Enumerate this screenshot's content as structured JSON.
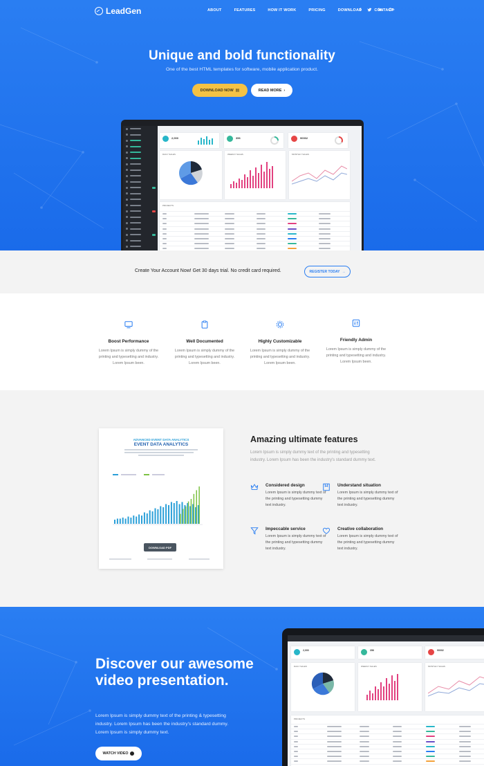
{
  "brand": {
    "name": "LeadGen"
  },
  "nav": {
    "items": [
      "ABOUT",
      "FEATURES",
      "HOW IT WORK",
      "PRICING",
      "DOWNLOAD",
      "CONTACT"
    ],
    "social": [
      "f",
      "t",
      "in",
      "G+"
    ]
  },
  "hero": {
    "title": "Unique and bold functionality",
    "subtitle": "One of the best HTML templates for software, mobile application product.",
    "download_label": "DOWNLOAD NOW",
    "readmore_label": "READ MORE"
  },
  "dashboard": {
    "kpis": [
      {
        "value": "2,000",
        "color": "#27b6c9"
      },
      {
        "value": "356",
        "color": "#35b89b"
      },
      {
        "value": "90002",
        "color": "#e64545"
      }
    ],
    "panels": [
      "DAILY SALES",
      "WEEKLY SALES",
      "MONTHLY SALES"
    ],
    "projects_label": "PROJECTS",
    "columns": [
      "#",
      "Project Name",
      "Start Date",
      "Due Date",
      "Status",
      "Assign"
    ]
  },
  "trial": {
    "text": "Create Your Account Now! Get 30 days trial. No credit card required.",
    "button": "REGISTER TODAY"
  },
  "features": [
    {
      "icon": "monitor-icon",
      "title": "Boost Performance",
      "desc": "Lorem Ipsum is simply dummy of the printing and typesetting and industry. Lorem Ipsum been."
    },
    {
      "icon": "clipboard-icon",
      "title": "Well Documented",
      "desc": "Lorem Ipsum is simply dummy of the printing and typesetting and industry. Lorem Ipsum been."
    },
    {
      "icon": "gear-icon",
      "title": "Highly Customizable",
      "desc": "Lorem Ipsum is simply dummy of the printing and typesetting and industry. Lorem Ipsum been."
    },
    {
      "icon": "sliders-icon",
      "title": "Friendly Admin",
      "desc": "Lorem Ipsum is simply dummy of the printing and typesetting and industry. Lorem Ipsum been."
    }
  ],
  "report": {
    "kicker": "ADVANCED EVENT DATA ANALYTICS",
    "title": "EVENT DATA ANALYTICS",
    "download_label": "DOWNLOAD PDF"
  },
  "amazing": {
    "title": "Amazing ultimate features",
    "desc": "Lorem Ipsum is simply dummy text of the printing and typesetting industry. Lorem Ipsum has been the industry's standard dummy text.",
    "items": [
      {
        "icon": "crown-icon",
        "title": "Considered design",
        "desc": "Lorem Ipsum is simply dummy text of the printing and typesetting dummy text industry."
      },
      {
        "icon": "book-icon",
        "title": "Understand situation",
        "desc": "Lorem Ipsum is simply dummy text of the printing and typesetting dummy text industry."
      },
      {
        "icon": "filter-icon",
        "title": "Impeccable service",
        "desc": "Lorem Ipsum is simply dummy text of the printing and typesetting dummy text industry."
      },
      {
        "icon": "heart-icon",
        "title": "Creative collaboration",
        "desc": "Lorem Ipsum is simply dummy text of the printing and typesetting dummy text industry."
      }
    ]
  },
  "video": {
    "title": "Discover our awesome video presentation.",
    "desc": "Lorem Ipsum is simply dummy text of the printing & typesetting industry. Lorem Ipsum has been the industry's standard dummy. Lorem Ipsum is simply dummy text.",
    "button": "WATCH VIDEO"
  },
  "colors": {
    "brand_blue": "#2a7ef2",
    "accent_yellow": "#f4c244",
    "chart_pink": "#e2407f",
    "chart_cyan": "#2a9fd8",
    "chart_green": "#7cc242"
  }
}
